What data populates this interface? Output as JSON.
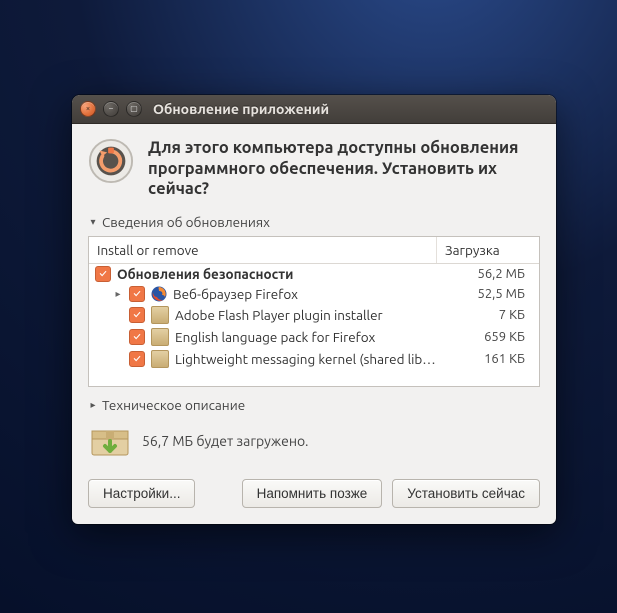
{
  "window": {
    "title": "Обновление приложений"
  },
  "hero": {
    "headline": "Для этого компьютера доступны обновления программного обеспечения. Установить их сейчас?"
  },
  "details_disclosure": "Сведения об обновлениях",
  "columns": {
    "name": "Install or remove",
    "size": "Загрузка"
  },
  "updates": {
    "group": {
      "label": "Обновления безопасности",
      "size": "56,2 МБ"
    },
    "items": [
      {
        "label": "Веб-браузер Firefox",
        "size": "52,5 МБ",
        "icon": "firefox",
        "expandable": true
      },
      {
        "label": "Adobe Flash Player plugin installer",
        "size": "7 КБ",
        "icon": "generic"
      },
      {
        "label": "English language pack for Firefox",
        "size": "659 КБ",
        "icon": "generic"
      },
      {
        "label": "Lightweight messaging kernel (shared lib…",
        "size": "161 КБ",
        "icon": "generic"
      }
    ]
  },
  "tech_disclosure": "Техническое описание",
  "download_summary": "56,7 МБ будет загружено.",
  "buttons": {
    "settings": "Настройки...",
    "later": "Напомнить позже",
    "install": "Установить сейчас"
  }
}
